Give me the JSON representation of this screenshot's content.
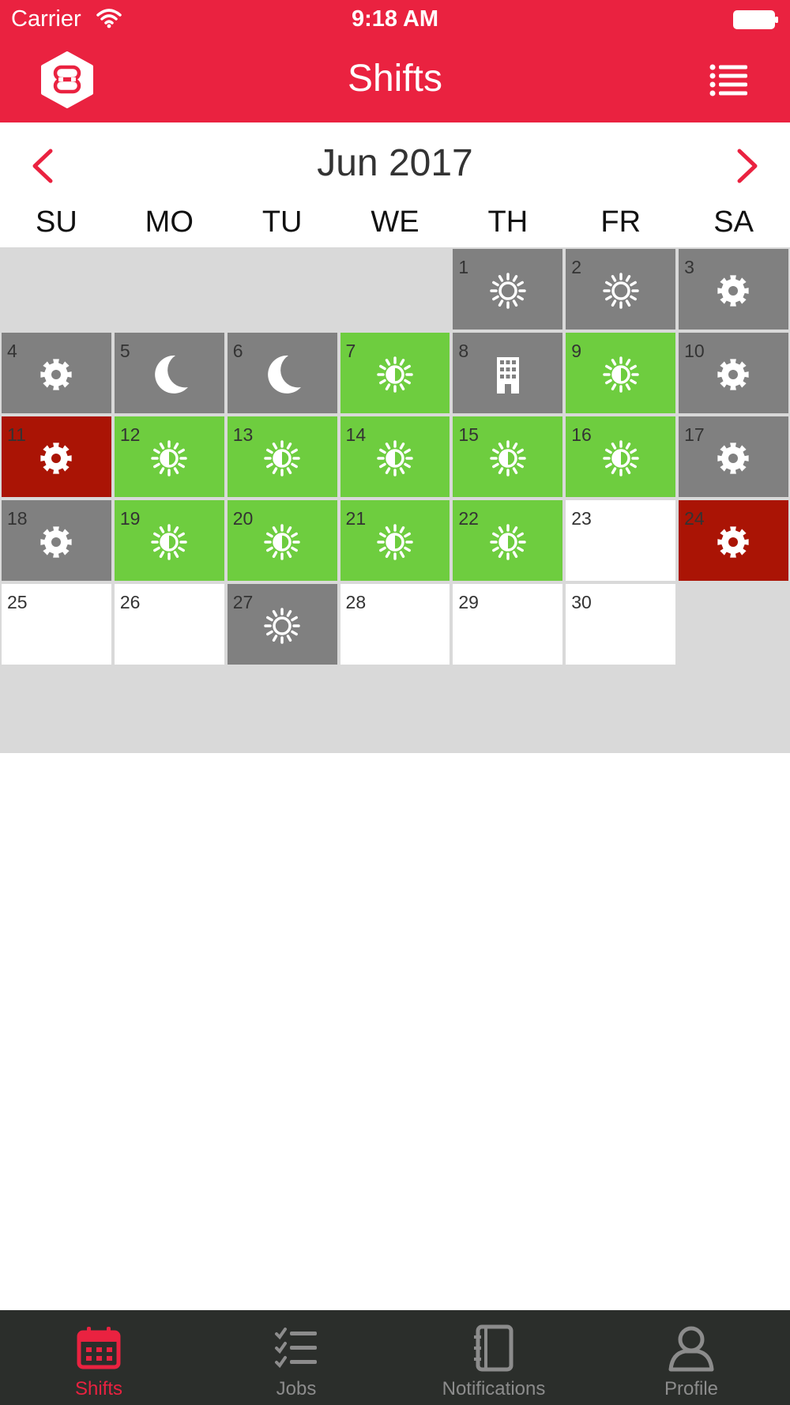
{
  "status_bar": {
    "carrier": "Carrier",
    "time": "9:18 AM"
  },
  "nav": {
    "title": "Shifts"
  },
  "calendar": {
    "month_label": "Jun 2017",
    "weekdays": [
      "SU",
      "MO",
      "TU",
      "WE",
      "TH",
      "FR",
      "SA"
    ],
    "leading_blank_days": 4,
    "days": [
      {
        "day": "1",
        "status": "gray",
        "icon": "sun-icon"
      },
      {
        "day": "2",
        "status": "gray",
        "icon": "sun-icon"
      },
      {
        "day": "3",
        "status": "gray",
        "icon": "gear-icon"
      },
      {
        "day": "4",
        "status": "gray",
        "icon": "gear-icon"
      },
      {
        "day": "5",
        "status": "gray",
        "icon": "moon-icon"
      },
      {
        "day": "6",
        "status": "gray",
        "icon": "moon-icon"
      },
      {
        "day": "7",
        "status": "green",
        "icon": "half-sun-icon"
      },
      {
        "day": "8",
        "status": "gray",
        "icon": "building-icon"
      },
      {
        "day": "9",
        "status": "green",
        "icon": "half-sun-icon"
      },
      {
        "day": "10",
        "status": "gray",
        "icon": "gear-icon"
      },
      {
        "day": "11",
        "status": "red",
        "icon": "gear-icon"
      },
      {
        "day": "12",
        "status": "green",
        "icon": "half-sun-icon"
      },
      {
        "day": "13",
        "status": "green",
        "icon": "half-sun-icon"
      },
      {
        "day": "14",
        "status": "green",
        "icon": "half-sun-icon"
      },
      {
        "day": "15",
        "status": "green",
        "icon": "half-sun-icon"
      },
      {
        "day": "16",
        "status": "green",
        "icon": "half-sun-icon"
      },
      {
        "day": "17",
        "status": "gray",
        "icon": "gear-icon"
      },
      {
        "day": "18",
        "status": "gray",
        "icon": "gear-icon"
      },
      {
        "day": "19",
        "status": "green",
        "icon": "half-sun-icon"
      },
      {
        "day": "20",
        "status": "green",
        "icon": "half-sun-icon"
      },
      {
        "day": "21",
        "status": "green",
        "icon": "half-sun-icon"
      },
      {
        "day": "22",
        "status": "green",
        "icon": "half-sun-icon"
      },
      {
        "day": "23",
        "status": "white",
        "icon": ""
      },
      {
        "day": "24",
        "status": "red",
        "icon": "gear-icon"
      },
      {
        "day": "25",
        "status": "white",
        "icon": ""
      },
      {
        "day": "26",
        "status": "white",
        "icon": ""
      },
      {
        "day": "27",
        "status": "gray",
        "icon": "sun-icon"
      },
      {
        "day": "28",
        "status": "white",
        "icon": ""
      },
      {
        "day": "29",
        "status": "white",
        "icon": ""
      },
      {
        "day": "30",
        "status": "white",
        "icon": ""
      }
    ]
  },
  "tabs": [
    {
      "label": "Shifts",
      "icon": "calendar-icon",
      "active": true
    },
    {
      "label": "Jobs",
      "icon": "checklist-icon",
      "active": false
    },
    {
      "label": "Notifications",
      "icon": "notebook-icon",
      "active": false
    },
    {
      "label": "Profile",
      "icon": "person-icon",
      "active": false
    }
  ],
  "colors": {
    "brand_red": "#ea2240",
    "shift_green": "#6ecd3f",
    "shift_gray": "#808080",
    "shift_dark_red": "#aa1405",
    "tabbar_bg": "#2b2e2b"
  }
}
